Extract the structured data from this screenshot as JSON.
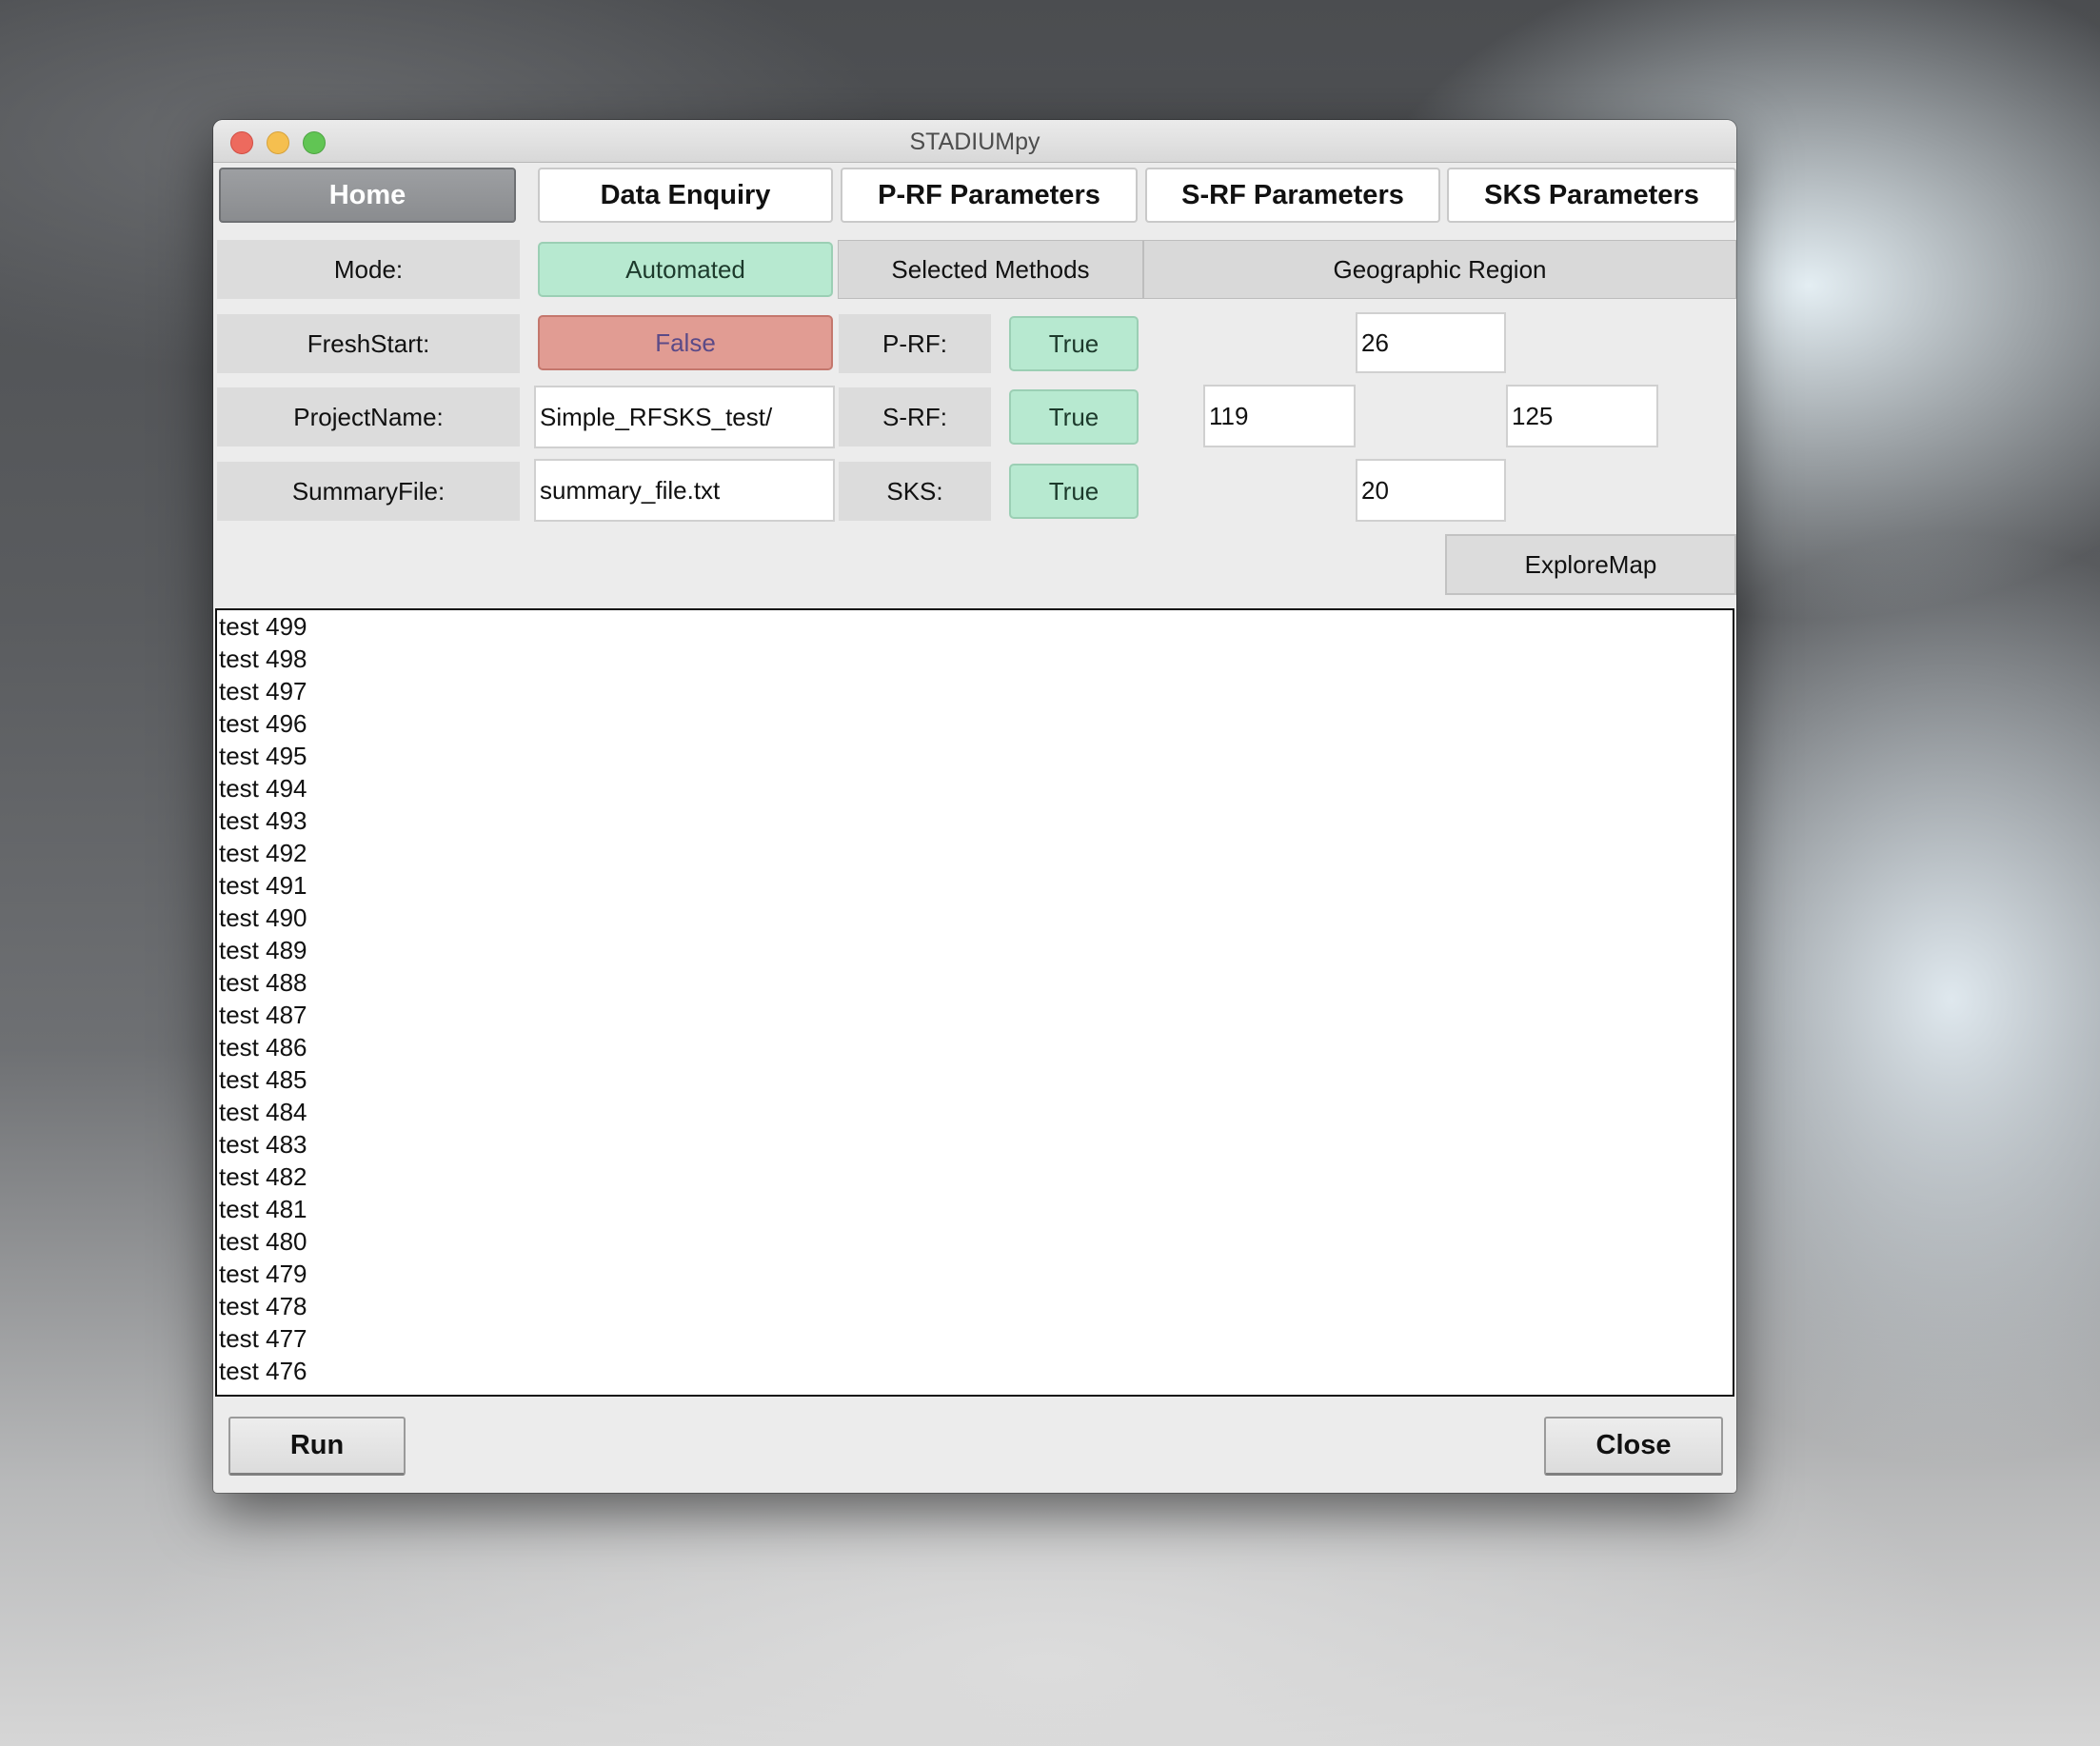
{
  "window": {
    "title": "STADIUMpy"
  },
  "tabs": [
    {
      "label": "Home"
    },
    {
      "label": "Data Enquiry"
    },
    {
      "label": "P-RF Parameters"
    },
    {
      "label": "S-RF Parameters"
    },
    {
      "label": "SKS Parameters"
    }
  ],
  "form": {
    "mode_label": "Mode:",
    "mode_value": "Automated",
    "fresh_label": "FreshStart:",
    "fresh_value": "False",
    "project_label": "ProjectName:",
    "project_value": "Simple_RFSKS_test/",
    "summary_label": "SummaryFile:",
    "summary_value": "summary_file.txt"
  },
  "methods": {
    "header": "Selected Methods",
    "prf_label": "P-RF:",
    "prf_value": "True",
    "srf_label": "S-RF:",
    "srf_value": "True",
    "sks_label": "SKS:",
    "sks_value": "True"
  },
  "region": {
    "header": "Geographic Region",
    "north": "26",
    "west": "119",
    "east": "125",
    "south": "20",
    "explore_label": "ExploreMap"
  },
  "log": {
    "lines": [
      "test 499",
      "test 498",
      "test 497",
      "test 496",
      "test 495",
      "test 494",
      "test 493",
      "test 492",
      "test 491",
      "test 490",
      "test 489",
      "test 488",
      "test 487",
      "test 486",
      "test 485",
      "test 484",
      "test 483",
      "test 482",
      "test 481",
      "test 480",
      "test 479",
      "test 478",
      "test 477",
      "test 476"
    ]
  },
  "footer": {
    "run_label": "Run",
    "close_label": "Close"
  },
  "colors": {
    "true_green": "#b7e9d0",
    "false_red": "#e19c93",
    "active_tab": "#9d9fa2"
  }
}
